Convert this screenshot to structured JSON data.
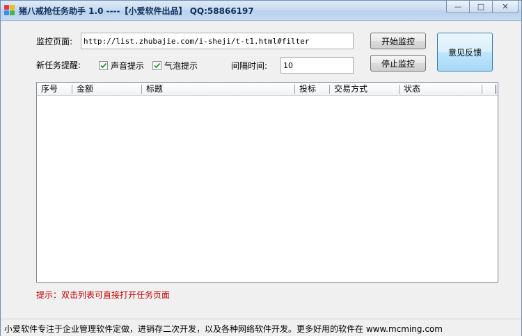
{
  "window": {
    "title": "猪八戒抢任务助手 1.0 ----【小爱软件出品】 QQ:58866197",
    "minimize_glyph": "—",
    "maximize_glyph": "□",
    "close_glyph": "✕"
  },
  "monitor": {
    "page_label": "监控页面:",
    "url_value": "http://list.zhubajie.com/i-sheji/t-t1.html#filter",
    "reminder_label": "新任务提醒:",
    "sound_label": "声音提示",
    "sound_checked": true,
    "bubble_label": "气泡提示",
    "bubble_checked": true,
    "interval_label": "间隔时间:",
    "interval_value": "10"
  },
  "buttons": {
    "start": "开始监控",
    "stop": "停止监控",
    "feedback": "意见反馈"
  },
  "list": {
    "columns": [
      "序号",
      "金额",
      "标题",
      "投标",
      "交易方式",
      "状态"
    ],
    "rows": []
  },
  "hint": "提示：双击列表可直接打开任务页面",
  "status": "小爱软件专注于企业管理软件定做，进销存二次开发，以及各种网络软件开发。更多好用的软件在 www.mcming.com"
}
